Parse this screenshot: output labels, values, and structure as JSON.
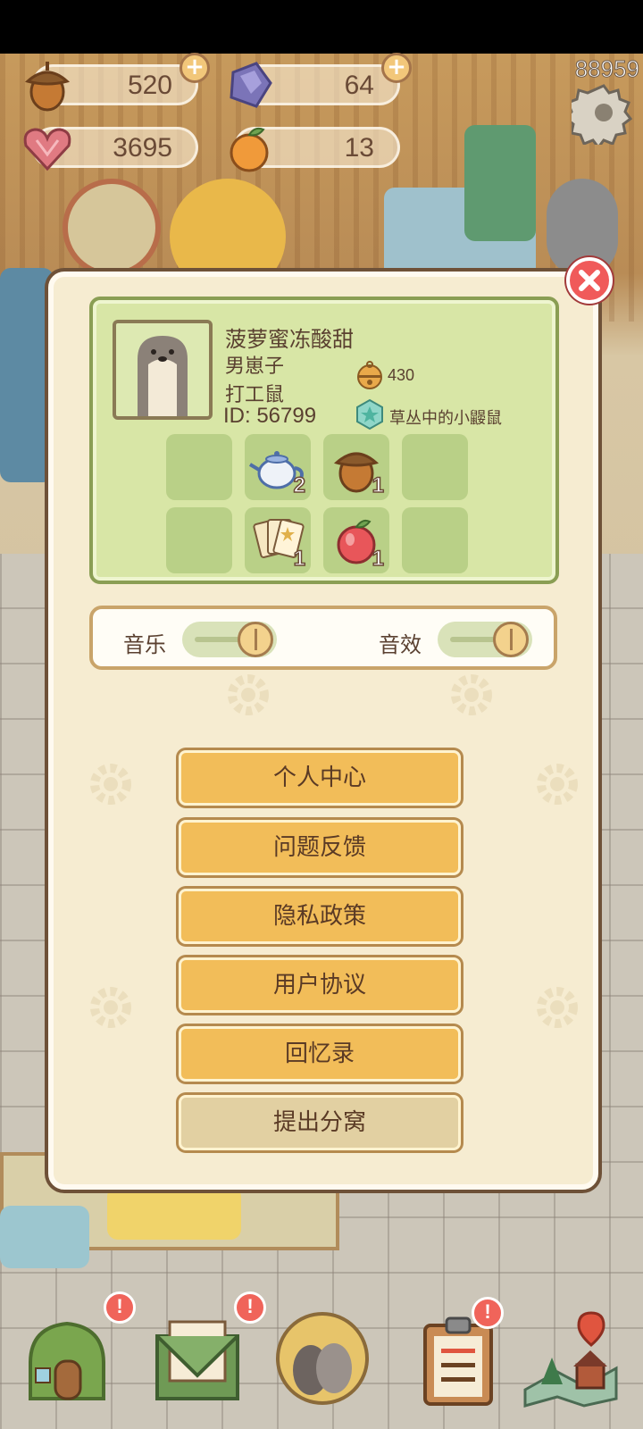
{
  "resources": {
    "acorn": {
      "value": "520",
      "icon": "acorn-icon"
    },
    "gem": {
      "value": "64",
      "icon": "purple-gem-icon"
    },
    "heart": {
      "value": "3695",
      "icon": "heart-gem-icon"
    },
    "orange": {
      "value": "13",
      "icon": "orange-icon"
    }
  },
  "top_counter": "88959",
  "profile": {
    "nickname": "菠萝蜜冻酸甜",
    "title": "男崽子",
    "job": "打工鼠",
    "id": "ID: 56799",
    "bells": "430",
    "badge": "草丛中的小鼹鼠"
  },
  "inventory": [
    {
      "icon": "empty",
      "count": ""
    },
    {
      "icon": "teapot-icon",
      "count": "2"
    },
    {
      "icon": "acorn-icon",
      "count": "1"
    },
    {
      "icon": "empty",
      "count": ""
    },
    {
      "icon": "empty",
      "count": ""
    },
    {
      "icon": "cards-icon",
      "count": "1"
    },
    {
      "icon": "apple-icon",
      "count": "1"
    },
    {
      "icon": "empty",
      "count": ""
    }
  ],
  "settings": {
    "music_label": "音乐",
    "sfx_label": "音效",
    "music_on": true,
    "sfx_on": true
  },
  "menu": {
    "personal_center": "个人中心",
    "feedback": "问题反馈",
    "privacy": "隐私政策",
    "agreement": "用户协议",
    "memoirs": "回忆录",
    "leave_den": "提出分窝"
  },
  "colors": {
    "button": "#f2bd59",
    "button_alt": "#e2d0a2",
    "card": "#d8e6a6",
    "close": "#f05a5a"
  },
  "nav": {
    "notif_home": "!",
    "notif_mail": "!",
    "notif_tasks": "!"
  }
}
